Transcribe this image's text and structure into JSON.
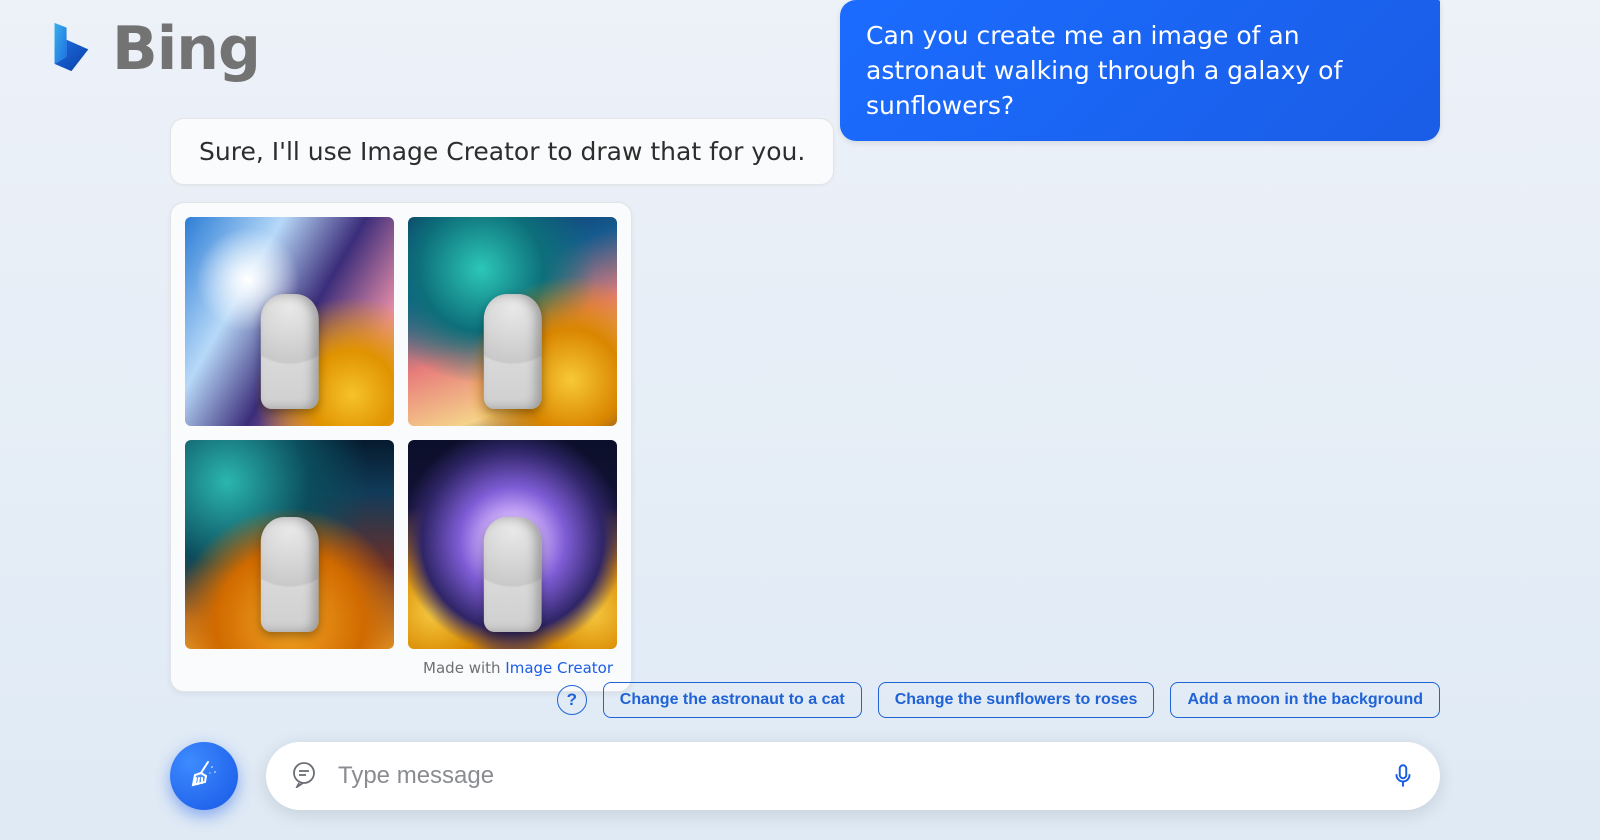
{
  "brand": {
    "name": "Bing"
  },
  "chat": {
    "user_message": "Can you create me an image of an astronaut walking through a galaxy of sunflowers?",
    "assistant_message": "Sure, I'll use Image Creator to draw that for you."
  },
  "image_card": {
    "caption_prefix": "Made with ",
    "caption_link": "Image Creator",
    "images": [
      "generated-image-1",
      "generated-image-2",
      "generated-image-3",
      "generated-image-4"
    ]
  },
  "suggestions": {
    "items": [
      "Change the astronaut to a cat",
      "Change the sunflowers to roses",
      "Add a moon in the background"
    ]
  },
  "composer": {
    "placeholder": "Type message"
  }
}
